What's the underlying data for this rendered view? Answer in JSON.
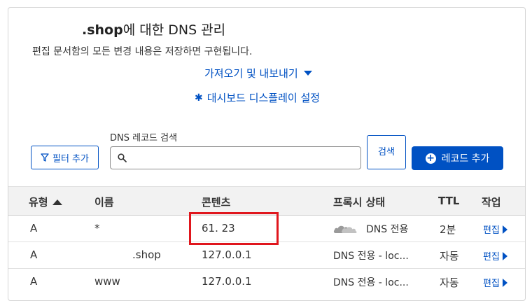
{
  "header": {
    "domain": ".shop",
    "title_suffix": "에 대한 DNS 관리",
    "subtitle": "편집 문서함의 모든 변경 내용은 저장하면 구현됩니다."
  },
  "links": {
    "import_export": "가져오기 및 내보내기",
    "dashboard_display": "대시보드 디스플레이 설정"
  },
  "toolbar": {
    "filter_label": "필터 추가",
    "search_label": "DNS 레코드 검색",
    "search_value": "",
    "search_button": "검색",
    "add_record": "레코드 추가"
  },
  "table": {
    "columns": [
      "유형",
      "이름",
      "콘텐츠",
      "프록시 상태",
      "TTL",
      "작업"
    ],
    "rows": [
      {
        "type": "A",
        "name": "*",
        "content": "61.        23",
        "proxy": "DNS 전용",
        "ttl": "2분",
        "action": "편집"
      },
      {
        "type": "A",
        "name": ".shop",
        "content": "127.0.0.1",
        "proxy": "DNS 전용 - loc...",
        "ttl": "자동",
        "action": "편집"
      },
      {
        "type": "A",
        "name": "www",
        "content": "127.0.0.1",
        "proxy": "DNS 전용 - loc...",
        "ttl": "자동",
        "action": "편집"
      }
    ]
  },
  "colors": {
    "accent": "#0051c3",
    "highlight": "#e0161d",
    "header_bg": "#f2f2f2"
  },
  "icons": [
    "caret-down-icon",
    "gear-icon",
    "filter-icon",
    "search-icon",
    "plus-circle-icon",
    "sort-ascending-icon",
    "cloud-icon",
    "chevron-right-icon"
  ]
}
